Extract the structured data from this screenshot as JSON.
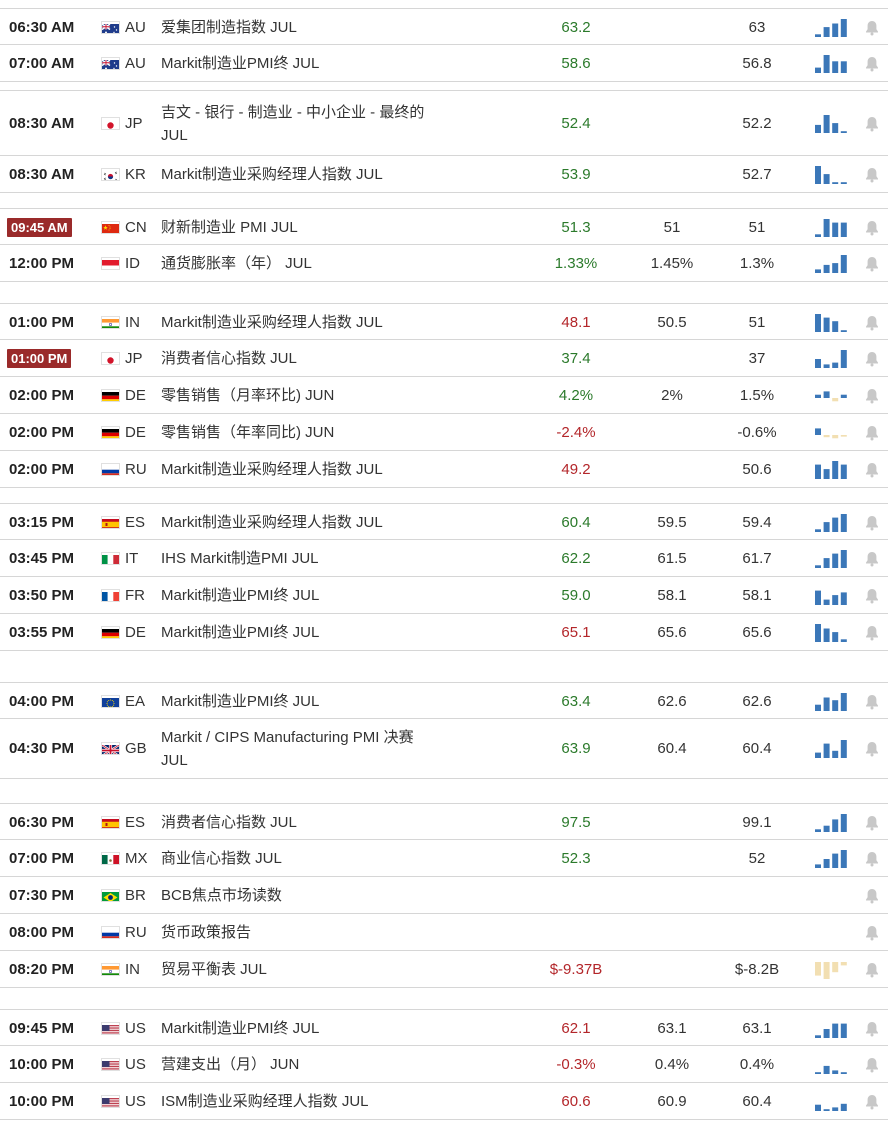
{
  "colors": {
    "actual_up": "#2b7a2b",
    "actual_down": "#b3262a",
    "live_time_badge": "#9a2a2a",
    "spark_bar": "#3b77b8",
    "spark_bar_neutral": "#f2dfb2",
    "bell": "#c8c8c8"
  },
  "events": [
    {
      "time": "06:30 AM",
      "flag": "flag-au",
      "cc": "AU",
      "name": "爱集团制造指数 JUL",
      "actual": "63.2",
      "forecast": "",
      "previous": "63",
      "trend": "up",
      "bars": [
        0.15,
        0.55,
        0.75,
        1
      ]
    },
    {
      "time": "07:00 AM",
      "flag": "flag-au",
      "cc": "AU",
      "name": "Markit制造业PMI终 JUL",
      "actual": "58.6",
      "forecast": "",
      "previous": "56.8",
      "trend": "up",
      "bars": [
        0.3,
        1,
        0.65,
        0.65
      ]
    },
    {
      "time": "08:30 AM",
      "flag": "flag-jp",
      "cc": "JP",
      "name": "吉文 - 银行 - 制造业 - 中小企业 - 最终的 JUL",
      "actual": "52.4",
      "forecast": "",
      "previous": "52.2",
      "trend": "up",
      "bars": [
        0.45,
        1,
        0.55,
        0.1
      ]
    },
    {
      "time": "08:30 AM",
      "flag": "flag-kr",
      "cc": "KR",
      "name": "Markit制造业采购经理人指数 JUL",
      "actual": "53.9",
      "forecast": "",
      "previous": "52.7",
      "trend": "up",
      "bars": [
        1,
        0.55,
        0.1,
        0.1
      ]
    },
    {
      "time": "09:45 AM",
      "live": true,
      "flag": "flag-cn",
      "cc": "CN",
      "name": "财新制造业 PMI JUL",
      "actual": "51.3",
      "forecast": "51",
      "previous": "51",
      "trend": "up",
      "bars": [
        0.15,
        1,
        0.8,
        0.8
      ]
    },
    {
      "time": "12:00 PM",
      "flag": "flag-id",
      "cc": "ID",
      "name": "通货膨胀率（年） JUL",
      "actual": "1.33%",
      "forecast": "1.45%",
      "previous": "1.3%",
      "trend": "up",
      "bars": [
        0.2,
        0.45,
        0.55,
        1
      ]
    },
    {
      "time": "01:00 PM",
      "flag": "flag-in",
      "cc": "IN",
      "name": "Markit制造业采购经理人指数 JUL",
      "actual": "48.1",
      "forecast": "50.5",
      "previous": "51",
      "trend": "down",
      "bars": [
        1,
        0.8,
        0.6,
        0.1
      ]
    },
    {
      "time": "01:00 PM",
      "live": true,
      "flag": "flag-jp",
      "cc": "JP",
      "name": "消费者信心指数 JUL",
      "actual": "37.4",
      "forecast": "",
      "previous": "37",
      "trend": "up",
      "bars": [
        0.5,
        0.2,
        0.3,
        1
      ]
    },
    {
      "time": "02:00 PM",
      "flag": "flag-de",
      "cc": "DE",
      "name": "零售销售（月率环比) JUN",
      "actual": "4.2%",
      "forecast": "2%",
      "previous": "1.5%",
      "trend": "up",
      "bars": [
        0.3,
        0.6,
        -0.3,
        0.3
      ]
    },
    {
      "time": "02:00 PM",
      "flag": "flag-de",
      "cc": "DE",
      "name": "零售销售（年率同比) JUN",
      "actual": "-2.4%",
      "forecast": "",
      "previous": "-0.6%",
      "trend": "down",
      "bars": [
        0.6,
        -0.2,
        -0.3,
        -0.15
      ]
    },
    {
      "time": "02:00 PM",
      "flag": "flag-ru",
      "cc": "RU",
      "name": "Markit制造业采购经理人指数 JUL",
      "actual": "49.2",
      "forecast": "",
      "previous": "50.6",
      "trend": "down",
      "bars": [
        0.8,
        0.55,
        1,
        0.8
      ]
    },
    {
      "time": "03:15 PM",
      "flag": "flag-es",
      "cc": "ES",
      "name": "Markit制造业采购经理人指数 JUL",
      "actual": "60.4",
      "forecast": "59.5",
      "previous": "59.4",
      "trend": "up",
      "bars": [
        0.15,
        0.55,
        0.8,
        1
      ]
    },
    {
      "time": "03:45 PM",
      "flag": "flag-it",
      "cc": "IT",
      "name": "IHS Markit制造PMI JUL",
      "actual": "62.2",
      "forecast": "61.5",
      "previous": "61.7",
      "trend": "up",
      "bars": [
        0.15,
        0.55,
        0.8,
        1
      ]
    },
    {
      "time": "03:50 PM",
      "flag": "flag-fr",
      "cc": "FR",
      "name": "Markit制造业PMI终 JUL",
      "actual": "59.0",
      "forecast": "58.1",
      "previous": "58.1",
      "trend": "up",
      "bars": [
        0.8,
        0.3,
        0.55,
        0.7
      ]
    },
    {
      "time": "03:55 PM",
      "flag": "flag-de",
      "cc": "DE",
      "name": "Markit制造业PMI终 JUL",
      "actual": "65.1",
      "forecast": "65.6",
      "previous": "65.6",
      "trend": "down",
      "bars": [
        1,
        0.75,
        0.55,
        0.15
      ]
    },
    {
      "time": "04:00 PM",
      "flag": "flag-eu",
      "cc": "EA",
      "name": "Markit制造业PMI终 JUL",
      "actual": "63.4",
      "forecast": "62.6",
      "previous": "62.6",
      "trend": "up",
      "bars": [
        0.35,
        0.75,
        0.6,
        1
      ]
    },
    {
      "time": "04:30 PM",
      "flag": "flag-gb",
      "cc": "GB",
      "name": "Markit / CIPS Manufacturing PMI 决赛 JUL",
      "actual": "63.9",
      "forecast": "60.4",
      "previous": "60.4",
      "trend": "up",
      "bars": [
        0.3,
        0.8,
        0.4,
        1
      ]
    },
    {
      "time": "06:30 PM",
      "flag": "flag-es",
      "cc": "ES",
      "name": "消费者信心指数 JUL",
      "actual": "97.5",
      "forecast": "",
      "previous": "99.1",
      "trend": "up",
      "bars": [
        0.15,
        0.35,
        0.7,
        1
      ]
    },
    {
      "time": "07:00 PM",
      "flag": "flag-mx",
      "cc": "MX",
      "name": "商业信心指数 JUL",
      "actual": "52.3",
      "forecast": "",
      "previous": "52",
      "trend": "up",
      "bars": [
        0.2,
        0.5,
        0.8,
        1
      ]
    },
    {
      "time": "07:30 PM",
      "flag": "flag-br",
      "cc": "BR",
      "name": "BCB焦点市场读数",
      "actual": "",
      "forecast": "",
      "previous": "",
      "trend": "none",
      "bars": []
    },
    {
      "time": "08:00 PM",
      "flag": "flag-ru",
      "cc": "RU",
      "name": "货币政策报告",
      "actual": "",
      "forecast": "",
      "previous": "",
      "trend": "none",
      "bars": []
    },
    {
      "time": "08:20 PM",
      "flag": "flag-in",
      "cc": "IN",
      "name": "贸易平衡表 JUL",
      "actual": "$-9.37B",
      "forecast": "",
      "previous": "$-8.2B",
      "trend": "down",
      "bars": [
        -0.8,
        -1,
        -0.6,
        -0.2
      ],
      "neutral": true
    },
    {
      "time": "09:45 PM",
      "flag": "flag-us",
      "cc": "US",
      "name": "Markit制造业PMI终 JUL",
      "actual": "62.1",
      "forecast": "63.1",
      "previous": "63.1",
      "trend": "down",
      "bars": [
        0.15,
        0.5,
        0.8,
        0.8
      ]
    },
    {
      "time": "10:00 PM",
      "flag": "flag-us",
      "cc": "US",
      "name": "营建支出（月） JUN",
      "actual": "-0.3%",
      "forecast": "0.4%",
      "previous": "0.4%",
      "trend": "down",
      "bars": [
        0.1,
        0.45,
        0.2,
        0.1
      ]
    },
    {
      "time": "10:00 PM",
      "flag": "flag-us",
      "cc": "US",
      "name": "ISM制造业采购经理人指数 JUL",
      "actual": "60.6",
      "forecast": "60.9",
      "previous": "60.4",
      "trend": "down",
      "bars": [
        0.35,
        0.1,
        0.2,
        0.4
      ]
    }
  ]
}
